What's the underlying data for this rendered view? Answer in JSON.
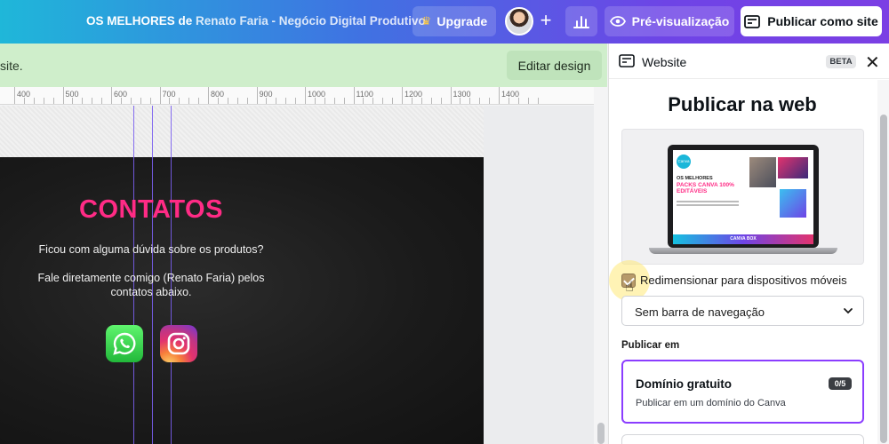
{
  "topbar": {
    "title_main": "OS MELHORES de",
    "title_author": "Renato Faria - Negócio Digital Produtivo",
    "upgrade_label": "Upgrade",
    "plus_label": "+",
    "preview_label": "Pré-visualização",
    "publish_label": "Publicar como site"
  },
  "notice": {
    "text": "site.",
    "edit_button": "Editar design"
  },
  "ruler": {
    "labels": [
      "400",
      "500",
      "600",
      "700",
      "800",
      "900",
      "1000",
      "1100",
      "1200",
      "1300",
      "1400"
    ]
  },
  "page": {
    "heading": "CONTATOS",
    "line1": "Ficou com alguma dúvida sobre os produtos?",
    "line2": "Fale diretamente comigo (Renato Faria) pelos",
    "line3": "contatos abaixo.",
    "icons": [
      "whatsapp-icon",
      "instagram-icon"
    ]
  },
  "panel": {
    "title": "Website",
    "beta": "BETA",
    "heading": "Publicar na web",
    "checkbox_label": "Redimensionar para dispositivos móveis",
    "checkbox_checked": true,
    "nav_select_value": "Sem barra de navegação",
    "section_label": "Publicar em",
    "domain": {
      "name": "Domínio gratuito",
      "description": "Publicar em um domínio do Canva",
      "count": "0/5"
    },
    "preview_mock": {
      "logo": "Canva",
      "h1": "OS MELHORES",
      "h2": "PACKS CANVA 100% EDITÁVEIS",
      "band": "CANVA BOX"
    }
  },
  "colors": {
    "accent_purple": "#8b3dff",
    "heading_pink": "#ff2b85",
    "notice_green": "#cfeecb"
  }
}
